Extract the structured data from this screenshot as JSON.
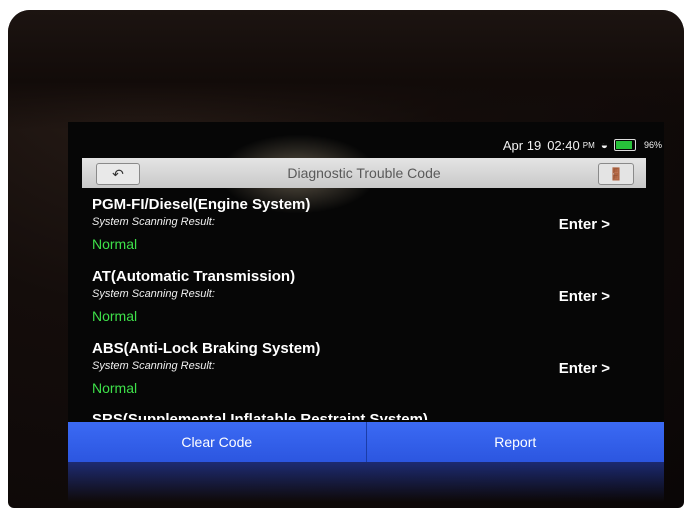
{
  "status_bar": {
    "date": "Apr 19",
    "time": "02:40",
    "ampm": "PM",
    "battery": "96%"
  },
  "header": {
    "title": "Diagnostic Trouble Code"
  },
  "systems": [
    {
      "name": "PGM-FI/Diesel(Engine System)",
      "result_label": "System Scanning Result:",
      "status": "Normal",
      "action": "Enter >"
    },
    {
      "name": "AT(Automatic Transmission)",
      "result_label": "System Scanning Result:",
      "status": "Normal",
      "action": "Enter >"
    },
    {
      "name": "ABS(Anti-Lock Braking System)",
      "result_label": "System Scanning Result:",
      "status": "Normal",
      "action": "Enter >"
    }
  ],
  "partial_item": "SRS(Supplemental Inflatable Restraint System)",
  "footer": {
    "clear_label": "Clear Code",
    "report_label": "Report"
  },
  "colors": {
    "accent": "#2c56e0",
    "status_ok": "#3ee04a"
  }
}
